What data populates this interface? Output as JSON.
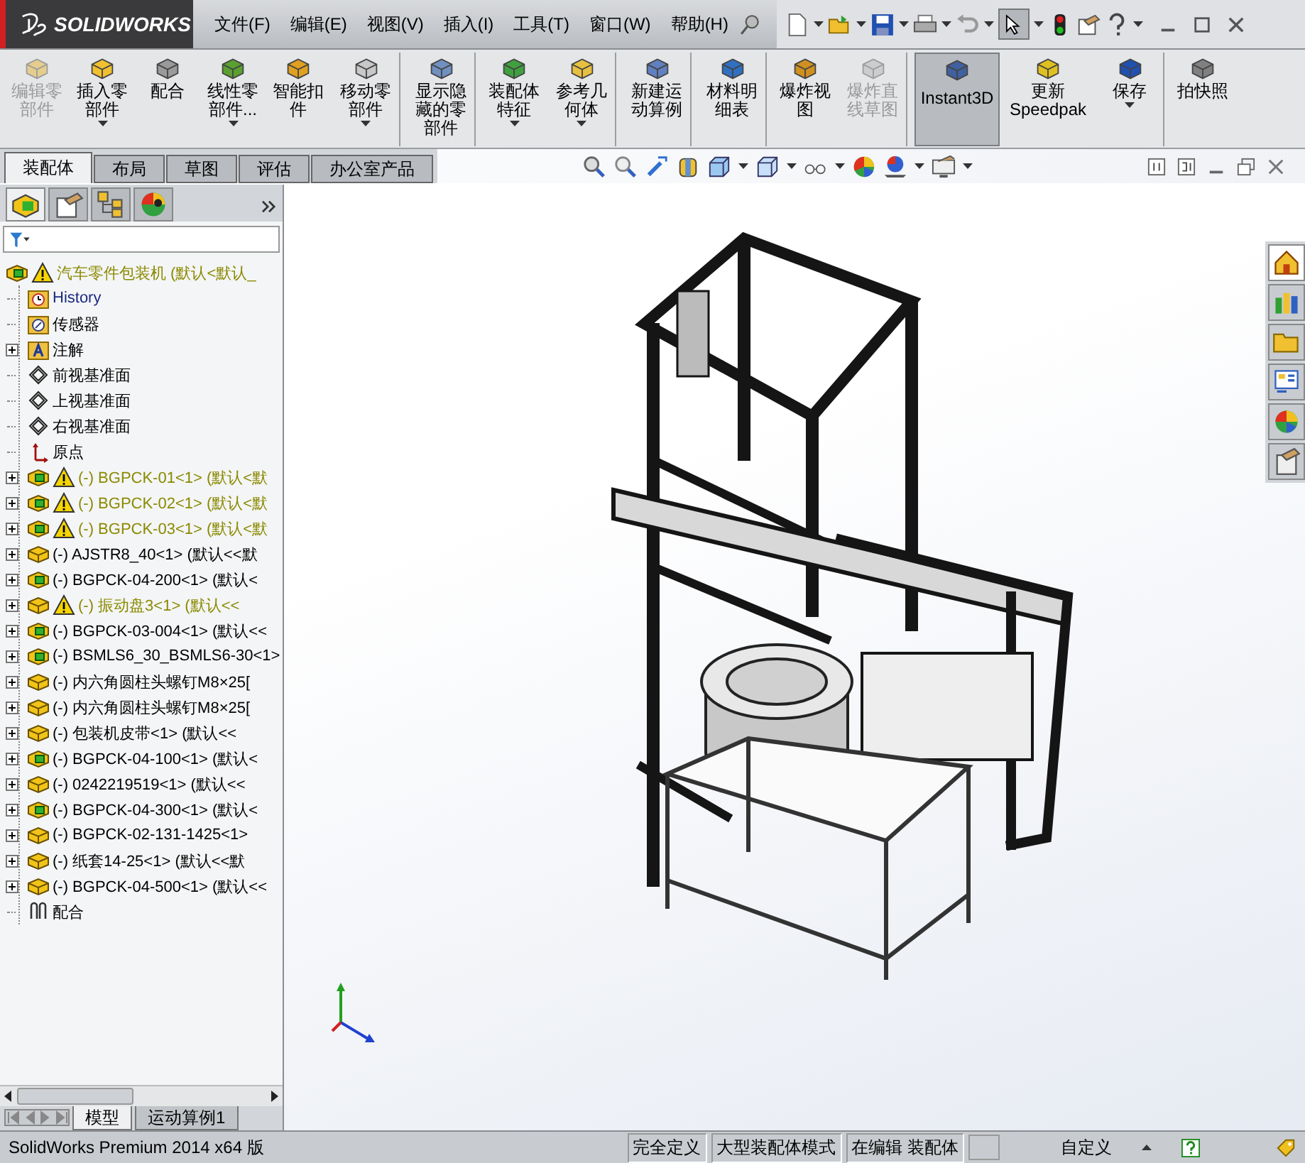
{
  "app": {
    "logo_text": "SOLIDWORKS"
  },
  "menu": [
    {
      "label": "文件(F)"
    },
    {
      "label": "编辑(E)"
    },
    {
      "label": "视图(V)"
    },
    {
      "label": "插入(I)"
    },
    {
      "label": "工具(T)"
    },
    {
      "label": "窗口(W)"
    },
    {
      "label": "帮助(H)"
    }
  ],
  "ribbon": [
    {
      "label": "编辑零部件",
      "disabled": true,
      "selected": false,
      "dropdown": false,
      "group_end": false
    },
    {
      "label": "插入零部件",
      "disabled": false,
      "selected": false,
      "dropdown": true,
      "group_end": false
    },
    {
      "label": "配合",
      "disabled": false,
      "selected": false,
      "dropdown": false,
      "group_end": false
    },
    {
      "label": "线性零部件...",
      "disabled": false,
      "selected": false,
      "dropdown": true,
      "group_end": false
    },
    {
      "label": "智能扣件",
      "disabled": false,
      "selected": false,
      "dropdown": false,
      "group_end": false
    },
    {
      "label": "移动零部件",
      "disabled": false,
      "selected": false,
      "dropdown": true,
      "group_end": true
    },
    {
      "label": "显示隐藏的零部件",
      "disabled": false,
      "selected": false,
      "dropdown": false,
      "group_end": true
    },
    {
      "label": "装配体特征",
      "disabled": false,
      "selected": false,
      "dropdown": true,
      "group_end": false
    },
    {
      "label": "参考几何体",
      "disabled": false,
      "selected": false,
      "dropdown": true,
      "group_end": true
    },
    {
      "label": "新建运动算例",
      "disabled": false,
      "selected": false,
      "dropdown": false,
      "group_end": true
    },
    {
      "label": "材料明细表",
      "disabled": false,
      "selected": false,
      "dropdown": false,
      "group_end": true
    },
    {
      "label": "爆炸视图",
      "disabled": false,
      "selected": false,
      "dropdown": false,
      "group_end": false
    },
    {
      "label": "爆炸直线草图",
      "disabled": true,
      "selected": false,
      "dropdown": false,
      "group_end": true
    },
    {
      "label": "Instant3D",
      "disabled": false,
      "selected": true,
      "dropdown": false,
      "group_end": false
    },
    {
      "label": "更新 Speedpak",
      "disabled": false,
      "selected": false,
      "dropdown": false,
      "group_end": false
    },
    {
      "label": "保存",
      "disabled": false,
      "selected": false,
      "dropdown": true,
      "group_end": true
    },
    {
      "label": "拍快照",
      "disabled": false,
      "selected": false,
      "dropdown": false,
      "group_end": false
    }
  ],
  "command_tabs": [
    {
      "label": "装配体",
      "selected": true
    },
    {
      "label": "布局",
      "selected": false
    },
    {
      "label": "草图",
      "selected": false
    },
    {
      "label": "评估",
      "selected": false
    },
    {
      "label": "办公室产品",
      "selected": false
    }
  ],
  "feature_tree": {
    "label": "汽车零件包装机 (默认<默认_",
    "warning": true,
    "kind": "assembly",
    "children": [
      {
        "kind": "history",
        "label": "History",
        "expandable": false,
        "warning": false
      },
      {
        "kind": "sensors",
        "label": "传感器",
        "expandable": false,
        "warning": false
      },
      {
        "kind": "annotations",
        "label": "注解",
        "expandable": true,
        "warning": false
      },
      {
        "kind": "plane",
        "label": "前视基准面",
        "expandable": false,
        "warning": false
      },
      {
        "kind": "plane",
        "label": "上视基准面",
        "expandable": false,
        "warning": false
      },
      {
        "kind": "plane",
        "label": "右视基准面",
        "expandable": false,
        "warning": false
      },
      {
        "kind": "origin",
        "label": "原点",
        "expandable": false,
        "warning": false
      },
      {
        "kind": "subassembly",
        "label": "(-) BGPCK-01<1> (默认<默",
        "expandable": true,
        "warning": true
      },
      {
        "kind": "subassembly",
        "label": "(-) BGPCK-02<1> (默认<默",
        "expandable": true,
        "warning": true
      },
      {
        "kind": "subassembly",
        "label": "(-) BGPCK-03<1> (默认<默",
        "expandable": true,
        "warning": true
      },
      {
        "kind": "part",
        "label": "(-) AJSTR8_40<1> (默认<<默",
        "expandable": true,
        "warning": false
      },
      {
        "kind": "subassembly",
        "label": "(-) BGPCK-04-200<1> (默认<",
        "expandable": true,
        "warning": false
      },
      {
        "kind": "part",
        "label": "(-) 振动盘3<1> (默认<<",
        "expandable": true,
        "warning": true
      },
      {
        "kind": "subassembly",
        "label": "(-) BGPCK-03-004<1> (默认<<",
        "expandable": true,
        "warning": false
      },
      {
        "kind": "subassembly",
        "label": "(-) BSMLS6_30_BSMLS6-30<1>",
        "expandable": true,
        "warning": false
      },
      {
        "kind": "part",
        "label": "(-) 内六角圆柱头螺钉M8×25[",
        "expandable": true,
        "warning": false
      },
      {
        "kind": "part",
        "label": "(-) 内六角圆柱头螺钉M8×25[",
        "expandable": true,
        "warning": false
      },
      {
        "kind": "part",
        "label": "(-) 包装机皮带<1> (默认<<",
        "expandable": true,
        "warning": false
      },
      {
        "kind": "subassembly",
        "label": "(-) BGPCK-04-100<1> (默认<",
        "expandable": true,
        "warning": false
      },
      {
        "kind": "part",
        "label": "(-) 0242219519<1> (默认<<",
        "expandable": true,
        "warning": false
      },
      {
        "kind": "subassembly",
        "label": "(-) BGPCK-04-300<1> (默认<",
        "expandable": true,
        "warning": false
      },
      {
        "kind": "part",
        "label": "(-) BGPCK-02-131-1425<1>",
        "expandable": true,
        "warning": false
      },
      {
        "kind": "part",
        "label": "(-) 纸套14-25<1> (默认<<默",
        "expandable": true,
        "warning": false
      },
      {
        "kind": "part",
        "label": "(-) BGPCK-04-500<1> (默认<<",
        "expandable": true,
        "warning": false
      },
      {
        "kind": "mates",
        "label": "配合",
        "expandable": false,
        "warning": false
      }
    ]
  },
  "bottom_tabs": [
    {
      "label": "模型",
      "selected": true
    },
    {
      "label": "运动算例1",
      "selected": false
    }
  ],
  "status_bar": {
    "product": "SolidWorks Premium 2014 x64 版",
    "fields": [
      "完全定义",
      "大型装配体模式",
      "在编辑 装配体"
    ],
    "units": "自定义"
  }
}
